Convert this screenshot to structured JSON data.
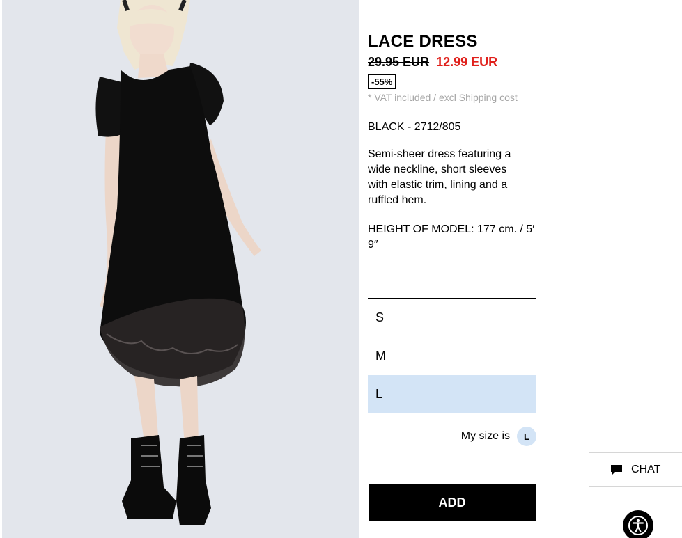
{
  "product": {
    "title": "LACE DRESS",
    "old_price": "29.95 EUR",
    "new_price": "12.99 EUR",
    "discount": "-55%",
    "vat_note": "* VAT included / excl Shipping cost",
    "color_ref": "BLACK - 2712/805",
    "description": "Semi-sheer dress featuring a wide neckline, short sleeves with elastic trim, lining and a ruffled hem.",
    "model_height": "HEIGHT OF MODEL: 177 cm. / 5′ 9″"
  },
  "sizes": [
    {
      "label": "S",
      "selected": false
    },
    {
      "label": "M",
      "selected": false
    },
    {
      "label": "L",
      "selected": true
    }
  ],
  "my_size": {
    "label": "My size is",
    "value": "L"
  },
  "add_button": "ADD",
  "chat": {
    "label": "CHAT",
    "icon": "chat-bubble-icon"
  },
  "accessibility": {
    "icon": "accessibility-icon"
  },
  "colors": {
    "sale_red": "#e0201b",
    "selected_size_bg": "#d3e4f6",
    "button_black": "#000000",
    "muted_text": "#a5a5a5"
  }
}
